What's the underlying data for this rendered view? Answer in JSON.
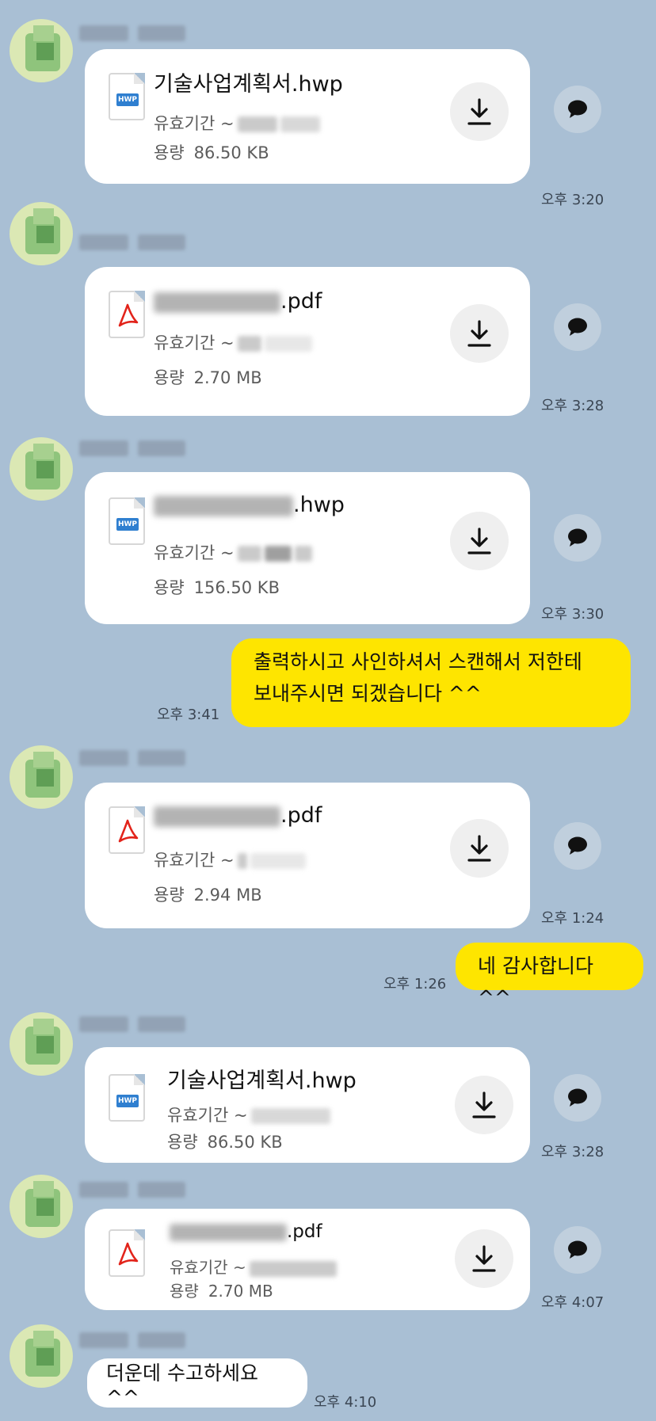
{
  "messages": [
    {
      "type": "file",
      "kind": "hwp",
      "name": "기술사업계획서.hwp",
      "name_prefix": "",
      "name_ext": "",
      "expiry_label": "유효기간 ~",
      "size_label": "용량",
      "size": "86.50 KB",
      "time": "오후 3:20"
    },
    {
      "type": "file",
      "kind": "pdf",
      "name": "",
      "name_prefix": "",
      "name_ext": ".pdf",
      "expiry_label": "유효기간 ~",
      "size_label": "용량",
      "size": "2.70 MB",
      "time": "오후 3:28"
    },
    {
      "type": "file",
      "kind": "hwp",
      "name": "",
      "name_prefix": "",
      "name_ext": ".hwp",
      "expiry_label": "유효기간 ~",
      "size_label": "용량",
      "size": "156.50 KB",
      "time": "오후 3:30"
    },
    {
      "type": "sent",
      "text_line1": "출력하시고 사인하셔서 스캔해서 저한테",
      "text_line2": "보내주시면 되겠습니다 ^^",
      "time": "오후 3:41"
    },
    {
      "type": "file",
      "kind": "pdf",
      "name": "",
      "name_prefix": "",
      "name_ext": ".pdf",
      "expiry_label": "유효기간 ~",
      "size_label": "용량",
      "size": "2.94 MB",
      "time": "오후 1:24"
    },
    {
      "type": "sent",
      "text_line1": "네 감사합니다 ^^",
      "time": "오후 1:26"
    },
    {
      "type": "file",
      "kind": "hwp",
      "name": "기술사업계획서.hwp",
      "expiry_label": "유효기간 ~",
      "size_label": "용량",
      "size": "86.50 KB",
      "time": "오후 3:28"
    },
    {
      "type": "file",
      "kind": "pdf",
      "name": "",
      "name_ext": ".pdf",
      "expiry_label": "유효기간 ~",
      "size_label": "용량",
      "size": "2.70 MB",
      "time": "오후 4:07"
    },
    {
      "type": "received",
      "text": "더운데 수고하세요^^",
      "time": "오후 4:10"
    }
  ],
  "icons": {
    "download": "download-icon",
    "share": "speech-bubble-icon",
    "hwp": "hwp-file-icon",
    "pdf": "pdf-file-icon"
  },
  "colors": {
    "background": "#a9bfd4",
    "sent_bubble": "#fee500",
    "hwp_blue": "#2f7fd0",
    "pdf_red": "#e2231a"
  }
}
